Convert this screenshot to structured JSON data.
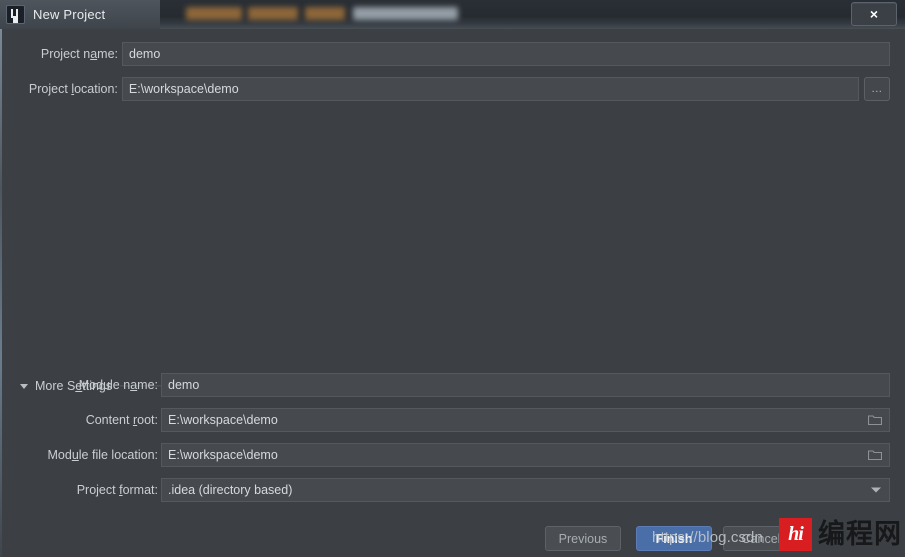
{
  "window": {
    "title": "New Project",
    "app_icon": "intellij-idea-icon",
    "close_label": "×"
  },
  "form": {
    "project_name": {
      "label_before": "Project n",
      "label_mnemonic": "a",
      "label_after": "me:",
      "value": "demo"
    },
    "project_location": {
      "label_before": "Project ",
      "label_mnemonic": "l",
      "label_after": "ocation:",
      "value": "E:\\workspace\\demo",
      "browse_label": "..."
    }
  },
  "more_settings": {
    "label_before": "More S",
    "label_mnemonic": "e",
    "label_after": "ttings",
    "expanded": true,
    "rows": [
      {
        "label_before": "Module n",
        "label_mnemonic": "a",
        "label_after": "me:",
        "value": "demo",
        "control": "text"
      },
      {
        "label_before": "Content ",
        "label_mnemonic": "r",
        "label_after": "oot:",
        "value": "E:\\workspace\\demo",
        "control": "folder"
      },
      {
        "label_before": "Mod",
        "label_mnemonic": "u",
        "label_after": "le file location:",
        "value": "E:\\workspace\\demo",
        "control": "folder"
      },
      {
        "label_before": "Project ",
        "label_mnemonic": "f",
        "label_after": "ormat:",
        "value": ".idea (directory based)",
        "control": "combo"
      }
    ]
  },
  "buttons": {
    "previous": "Previous",
    "finish": "Finish",
    "cancel": "Cancel"
  },
  "watermark": {
    "url": "https://blog.csdn",
    "logo_mark": "hi",
    "logo_text": "编程网"
  },
  "colors": {
    "dialog_bg": "#3c4044",
    "field_bg": "#464a4e",
    "accent_blue": "#4a6ea8",
    "text": "#c9ced3",
    "watermark_red": "#d81e20"
  }
}
